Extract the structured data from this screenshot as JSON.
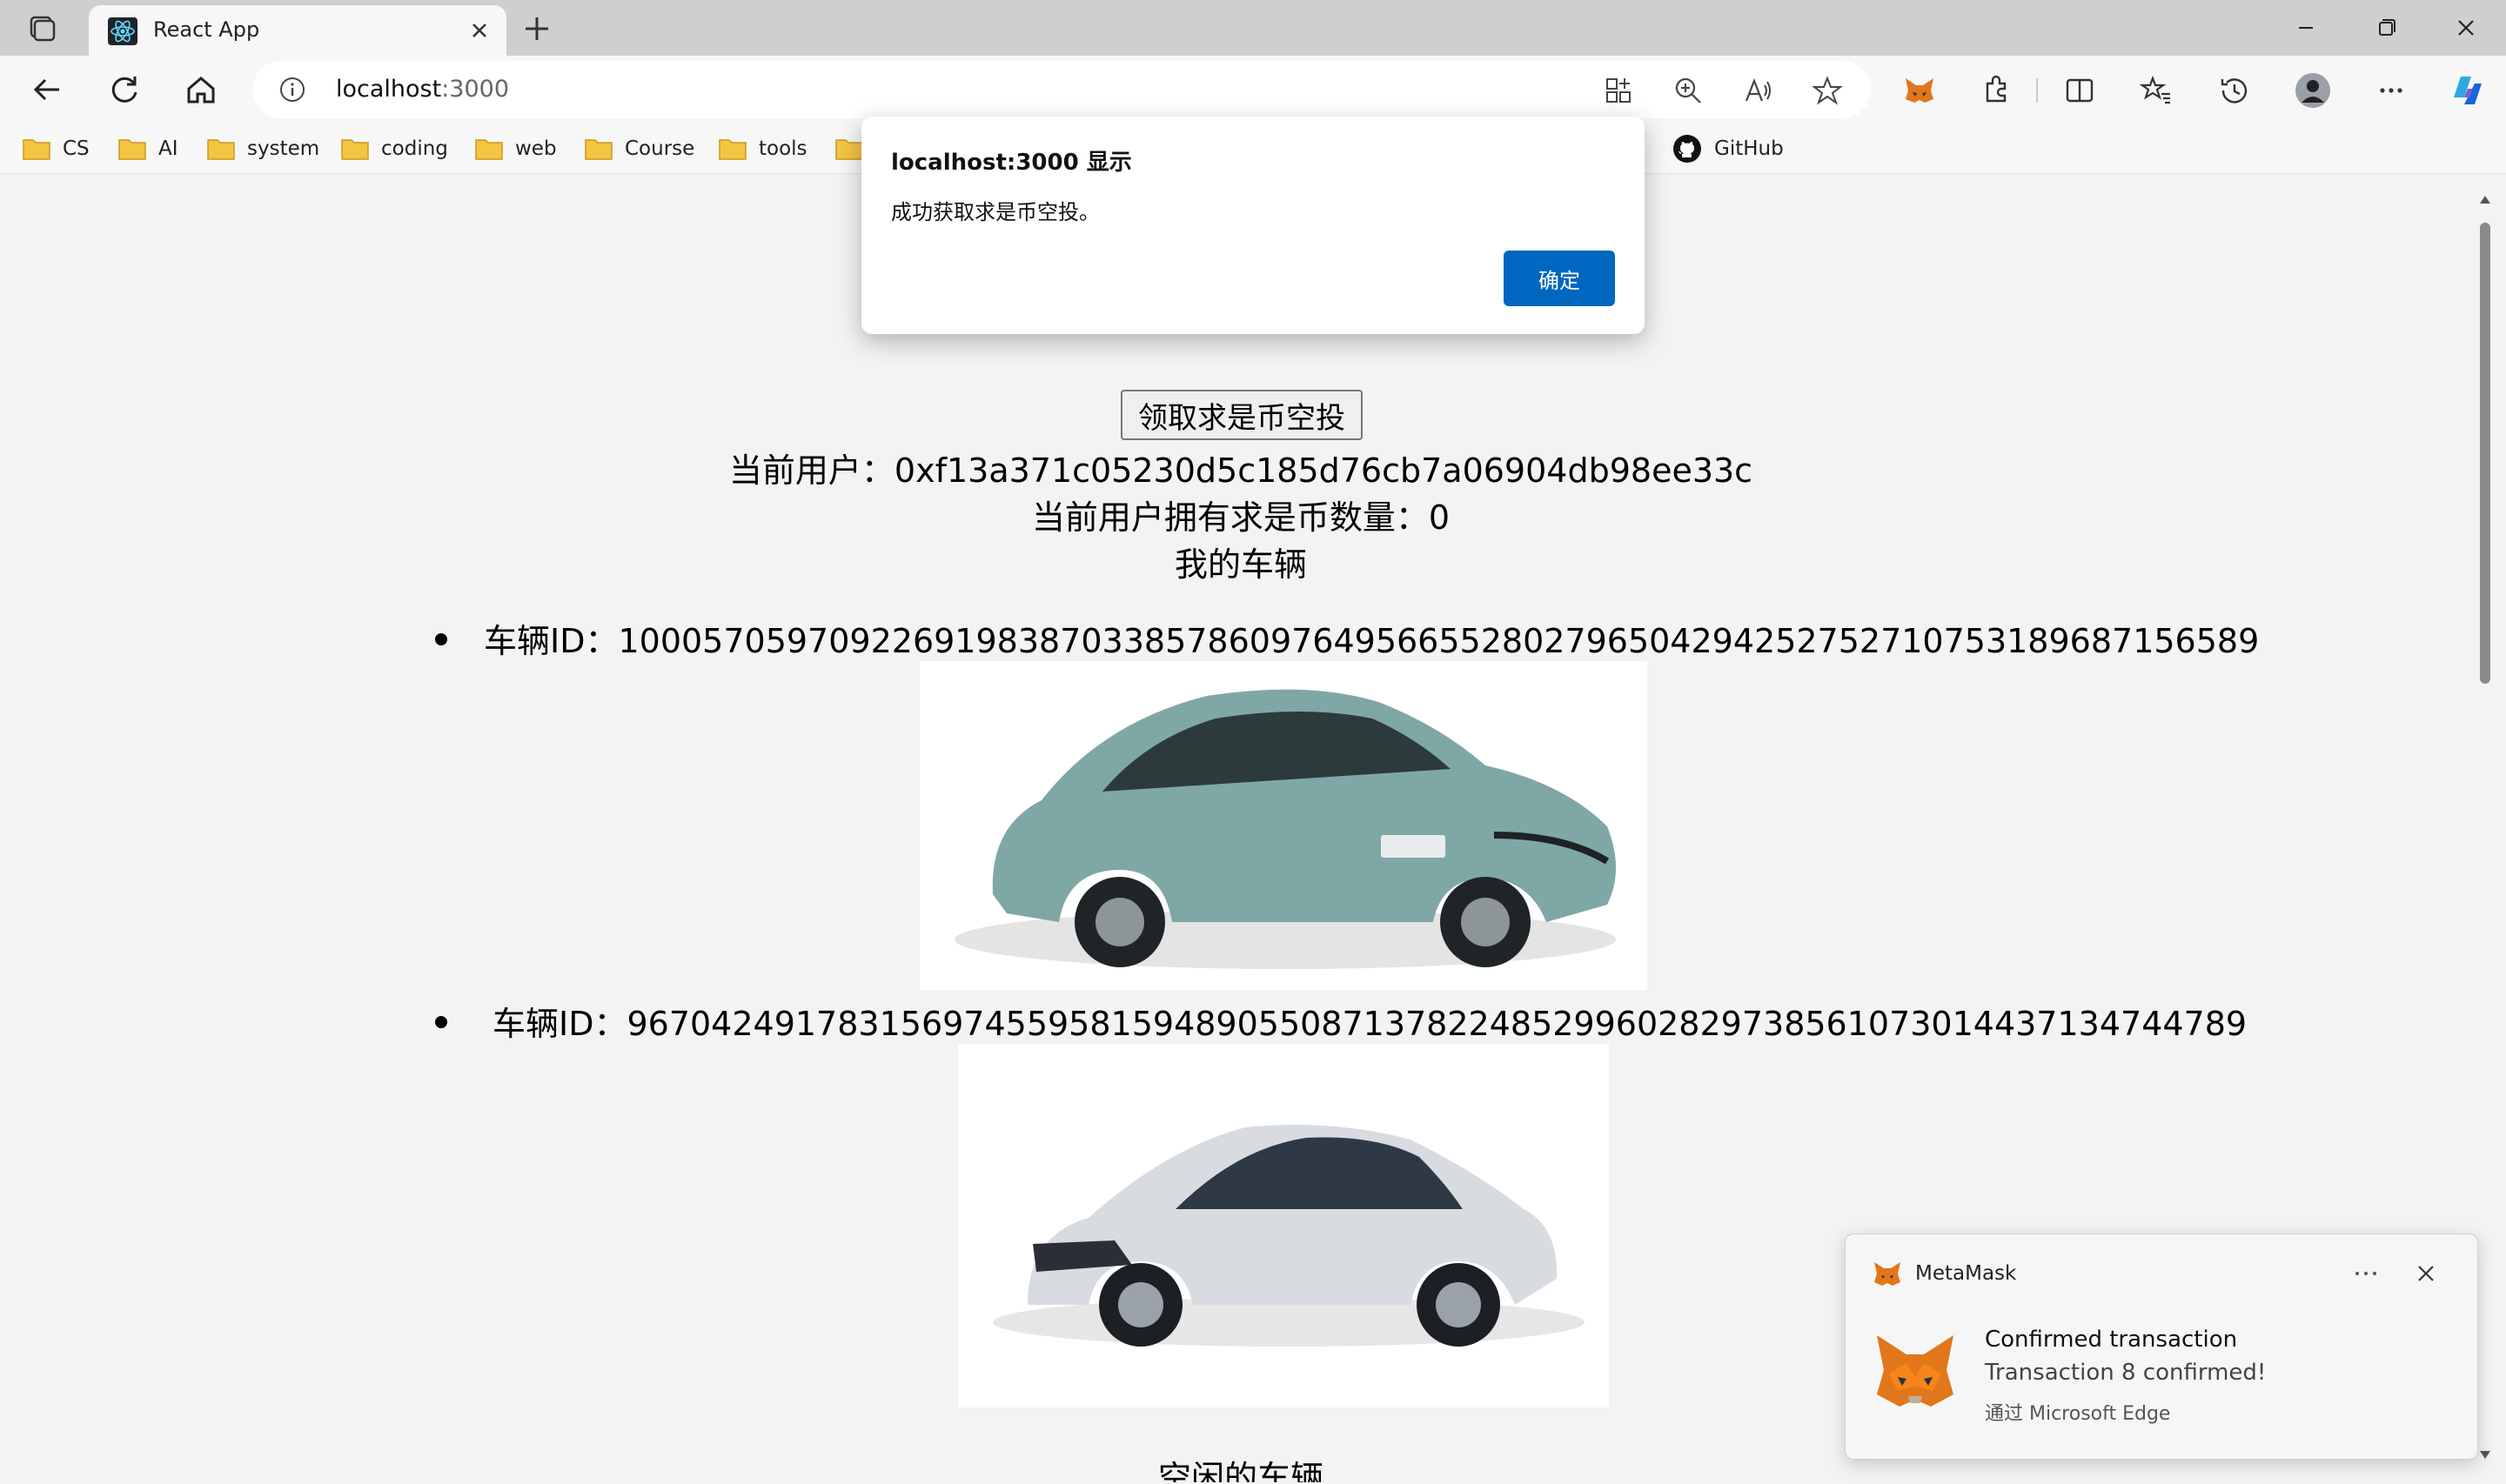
{
  "browser": {
    "tab_title": "React App",
    "address": {
      "host": "localhost",
      "port": ":3000"
    },
    "bookmarks": [
      {
        "label": "CS"
      },
      {
        "label": "AI"
      },
      {
        "label": "system"
      },
      {
        "label": "coding"
      },
      {
        "label": "web"
      },
      {
        "label": "Course"
      },
      {
        "label": "tools"
      },
      {
        "label": ""
      },
      {
        "label": "GitHub"
      }
    ]
  },
  "alert": {
    "title": "localhost:3000 显示",
    "message": "成功获取求是币空投。",
    "ok_label": "确定"
  },
  "page": {
    "airdrop_button": "领取求是币空投",
    "current_user": "当前用户：0xf13a371c05230d5c185d76cb7a06904db98ee33c",
    "balance": "当前用户拥有求是币数量：0",
    "my_vehicles_heading": "我的车辆",
    "vehicles": [
      {
        "label": "车辆ID：100057059709226919838703385786097649566552802796504294252752710753189687156589"
      },
      {
        "label": "车辆ID：96704249178315697455958159489055087137822485299602829738561073014437134744789"
      }
    ],
    "idle_vehicles_heading": "空闲的车辆"
  },
  "toast": {
    "app": "MetaMask",
    "title": "Confirmed transaction",
    "body": "Transaction 8 confirmed!",
    "source": "通过 Microsoft Edge"
  },
  "colors": {
    "accent": "#0067c0",
    "titlebar": "#cfcfcf",
    "page_bg": "#f3f3f3",
    "folder": "#f4c542",
    "car1_body": "#7fa7a6",
    "car2_body": "#d8dbe0"
  }
}
